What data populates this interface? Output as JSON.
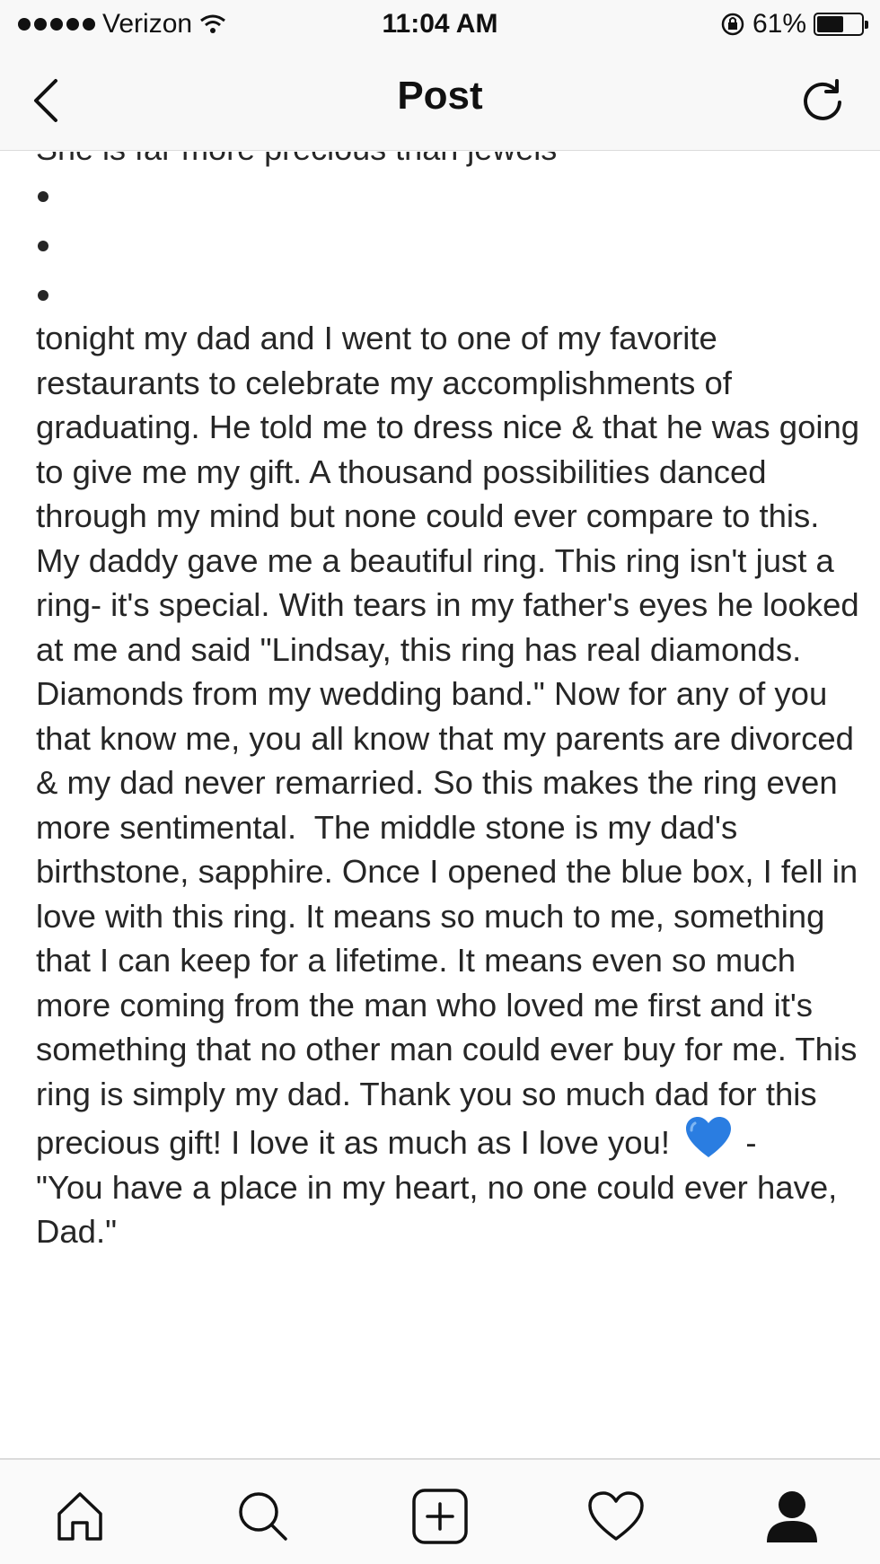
{
  "status_bar": {
    "carrier": "Verizon",
    "time": "11:04 AM",
    "battery": "61%",
    "battery_level": 0.61
  },
  "nav": {
    "title": "Post",
    "back_icon": "chevron-left-icon",
    "refresh_icon": "refresh-icon"
  },
  "post": {
    "cut_line": "She is far more precious than jewels",
    "bullets": [
      "•",
      "•",
      "•"
    ],
    "caption": "tonight my dad and I went to one of my favorite restaurants to celebrate my accomplishments of graduating. He told me to dress nice & that he was going to give me my gift. A thousand possibilities danced through my mind but none could ever compare to this. My daddy gave me a beautiful ring. This ring isn't just a ring- it's special. With tears in my father's eyes he looked at me and said \"Lindsay, this ring has real diamonds. Diamonds from my wedding band.\" Now for any of you that know me, you all know that my parents are divorced & my dad never remarried. So this makes the ring even more sentimental.  The middle stone is my dad's birthstone, sapphire. Once I opened the blue box, I fell in love with this ring. It means so much to me, something that I can keep for a lifetime. It means even so much more coming from the man who loved me first and it's something that no other man could ever buy for me. This ring is simply my dad. Thank you so much dad for this precious gift! I love it as much as I love you!",
    "heart_icon": "blue-heart-emoji-icon",
    "caption_dash": "-",
    "quote": "\"You have a place in my heart, no one could ever have, Dad.\"",
    "heart_color": "#2a7de1"
  },
  "tab_bar": {
    "items": [
      "home-icon",
      "search-icon",
      "add-post-icon",
      "activity-heart-icon",
      "profile-icon"
    ]
  }
}
